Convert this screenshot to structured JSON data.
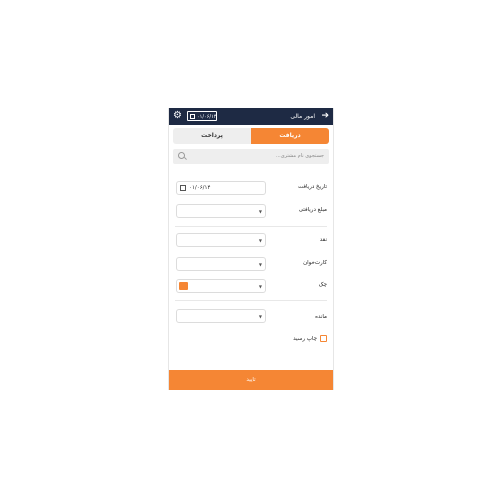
{
  "header": {
    "title": "امور مالی",
    "date": "۰۱/۰۶/۱۴",
    "back_icon": "arrow-right-icon",
    "settings_icon": "gear-icon"
  },
  "tabs": [
    {
      "label": "دریافت",
      "active": true
    },
    {
      "label": "پرداخت",
      "active": false
    }
  ],
  "search": {
    "placeholder": "جستجوی نام مشتری..."
  },
  "form": {
    "receive_date_label": "تاریخ دریافت",
    "receive_date_value": "۰۱/۰۶/۱۴",
    "received_amount_label": "مبلغ دریافتی",
    "cash_label": "نقد",
    "card_reader_label": "کارت‌خوان",
    "check_label": "چک",
    "remaining_label": "مانده",
    "print_receipt_label": "چاپ رسید"
  },
  "footer": {
    "confirm_label": "تایید"
  },
  "colors": {
    "accent": "#f58634",
    "header_bg": "#1e2a44"
  }
}
